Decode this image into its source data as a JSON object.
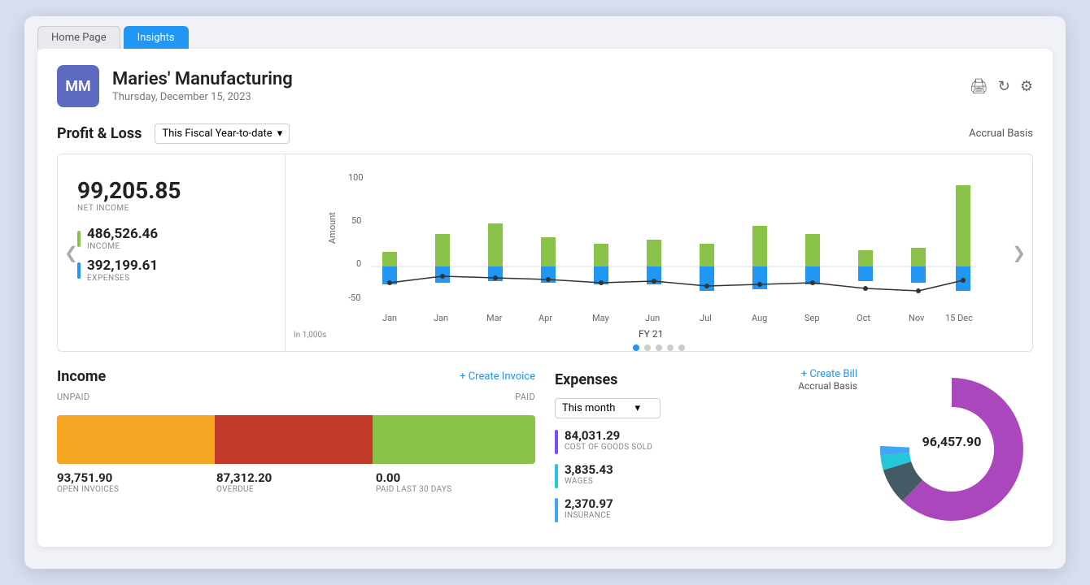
{
  "tabs": [
    {
      "label": "Home Page",
      "active": false
    },
    {
      "label": "Insights",
      "active": true
    }
  ],
  "company": {
    "initials": "MM",
    "name": "Maries' Manufacturing",
    "date": "Thursday, December 15, 2023"
  },
  "pl": {
    "title": "Profit & Loss",
    "period": "This Fiscal Year-to-date",
    "basis": "Accrual Basis",
    "net_income": "99,205.85",
    "net_income_label": "NET INCOME",
    "income_value": "486,526.46",
    "income_label": "INCOME",
    "expenses_value": "392,199.61",
    "expenses_label": "EXPENSES",
    "chart_fy": "FY 21",
    "in_1000s": "In 1,000s",
    "chart_months": [
      "Jan",
      "Jan",
      "Mar",
      "Apr",
      "May",
      "Jun",
      "Jul",
      "Aug",
      "Sep",
      "Oct",
      "Nov",
      "15 Dec"
    ]
  },
  "income": {
    "title": "Income",
    "create_link": "+ Create Invoice",
    "unpaid_label": "UNPAID",
    "paid_label": "PAID",
    "open_invoices_val": "93,751.90",
    "open_invoices_label": "OPEN INVOICES",
    "overdue_val": "87,312.20",
    "overdue_label": "OVERDUE",
    "paid_val": "0.00",
    "paid_label_sub": "PAID LAST 30 DAYS"
  },
  "expenses": {
    "title": "Expenses",
    "create_link": "+ Create Bill",
    "basis": "Accrual Basis",
    "period": "This month",
    "total": "96,457.90",
    "items": [
      {
        "label": "COST OF GOODS SOLD",
        "value": "84,031.29",
        "color": "#7c4dff"
      },
      {
        "label": "WAGES",
        "value": "3,835.43",
        "color": "#26c6da"
      },
      {
        "label": "INSURANCE",
        "value": "2,370.97",
        "color": "#42a5f5"
      }
    ]
  },
  "icons": {
    "print": "🖨",
    "refresh": "↻",
    "settings": "⚙",
    "left_arrow": "❮",
    "right_arrow": "❯",
    "dropdown": "▾"
  }
}
